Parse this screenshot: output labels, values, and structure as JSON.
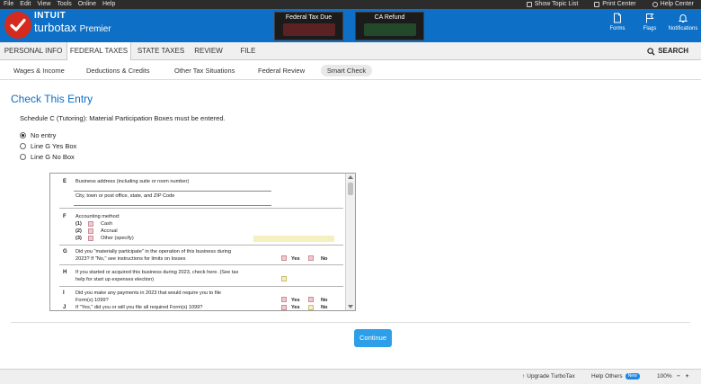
{
  "menubar": {
    "items": [
      "File",
      "Edit",
      "View",
      "Tools",
      "Online",
      "Help"
    ],
    "right": {
      "show_topic_list": "Show Topic List",
      "print_center": "Print Center",
      "help_center": "Help Center"
    }
  },
  "header": {
    "brand": "INTUIT",
    "product": "turbotax",
    "edition": "Premier",
    "federal_label": "Federal Tax Due",
    "state_label": "CA Refund",
    "buttons": {
      "forms": "Forms",
      "flags": "Flags",
      "notifications": "Notifications"
    },
    "icons": {
      "logo": "checkmark-icon",
      "forms": "document-icon",
      "flags": "flag-icon",
      "notifications": "bell-icon"
    }
  },
  "tabs": {
    "items": [
      "PERSONAL INFO",
      "FEDERAL TAXES",
      "STATE TAXES",
      "REVIEW",
      "FILE"
    ],
    "active": "FEDERAL TAXES",
    "search": "SEARCH"
  },
  "subnav": {
    "items": [
      "Wages & Income",
      "Deductions & Credits",
      "Other Tax Situations",
      "Federal Review",
      "Smart Check"
    ],
    "active": "Smart Check"
  },
  "main": {
    "title": "Check This Entry",
    "instruction": "Schedule C (Tutoring): Material Participation Boxes must be entered.",
    "options": [
      "No entry",
      "Line G Yes Box",
      "Line G No Box"
    ],
    "selected": "No entry",
    "continue": "Continue"
  },
  "form": {
    "e_letter": "E",
    "e_label": "Business address (including suite or room number)",
    "e_city": "City, town or post office, state, and ZIP Code",
    "f_letter": "F",
    "f_label": "Accounting method:",
    "f_options": [
      {
        "num": "(1)",
        "label": "Cash"
      },
      {
        "num": "(2)",
        "label": "Accrual"
      },
      {
        "num": "(3)",
        "label": "Other (specify)"
      }
    ],
    "g_letter": "G",
    "g_line1": "Did you \"materially participate\" in the operation of this business during",
    "g_line2": "2023? If \"No,\" see instructions for limits on losses",
    "h_letter": "H",
    "h_line1": "If you started or acquired this business during 2023, check here. (See tax",
    "h_line2": "help for start up expenses election)",
    "i_letter": "I",
    "i_line1": "Did you make any payments in 2023 that would require you to file",
    "i_line2": "Form(s) 1099?",
    "j_letter": "J",
    "j_line1": "If \"Yes,\" did you or will you file all required Form(s) 1099?",
    "yes": "Yes",
    "no": "No"
  },
  "statusbar": {
    "upgrade": "Upgrade TurboTax",
    "help_others": "Help Others",
    "new_badge": "New",
    "zoom": "100%",
    "zoom_minus": "−",
    "zoom_plus": "+"
  },
  "colors": {
    "header_blue": "#0d6fc5",
    "logo_red": "#d52b1e",
    "continue_blue": "#2d9fe8",
    "title_blue": "#0d6fc5"
  }
}
